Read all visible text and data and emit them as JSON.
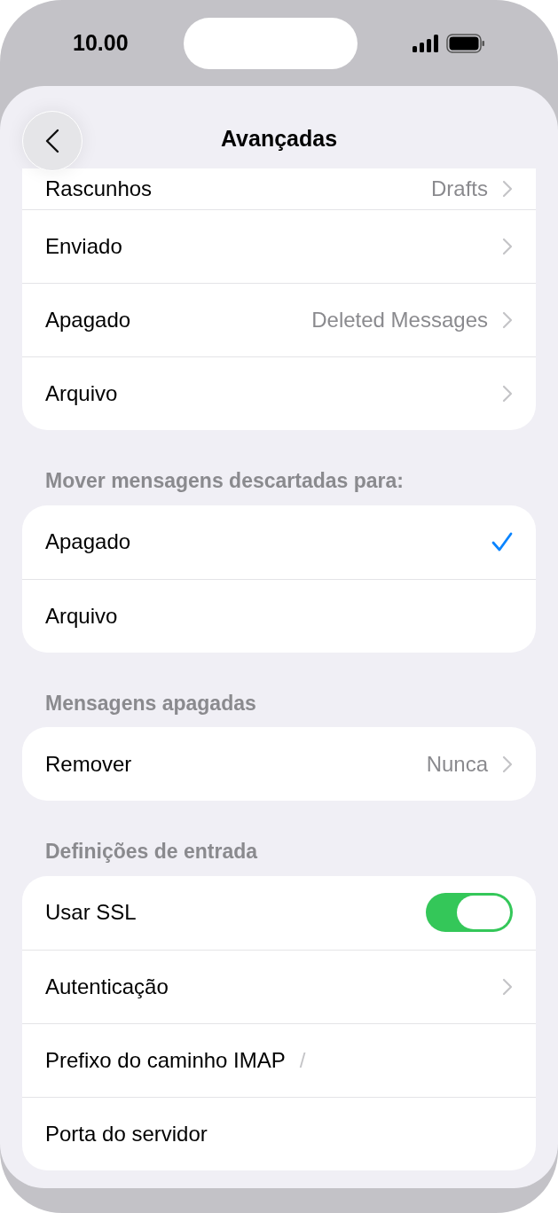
{
  "status_bar": {
    "time": "10.00"
  },
  "nav": {
    "title": "Avançadas"
  },
  "sections": [
    {
      "rows": [
        {
          "kind": "link",
          "label": "Rascunhos",
          "value": "Drafts"
        },
        {
          "kind": "link",
          "label": "Enviado"
        },
        {
          "kind": "link",
          "label": "Apagado",
          "value": "Deleted Messages"
        },
        {
          "kind": "link",
          "label": "Arquivo"
        }
      ]
    },
    {
      "header": "Mover mensagens descartadas para:",
      "rows": [
        {
          "kind": "choice",
          "label": "Apagado",
          "selected": true
        },
        {
          "kind": "choice",
          "label": "Arquivo",
          "selected": false
        }
      ]
    },
    {
      "header": "Mensagens apagadas",
      "rows": [
        {
          "kind": "link",
          "label": "Remover",
          "value": "Nunca"
        }
      ]
    },
    {
      "header": "Definições de entrada",
      "rows": [
        {
          "kind": "toggle",
          "label": "Usar SSL",
          "on": true
        },
        {
          "kind": "link",
          "label": "Autenticação"
        },
        {
          "kind": "field",
          "label": "Prefixo do caminho IMAP",
          "value": "/"
        },
        {
          "kind": "field",
          "label": "Porta do servidor"
        }
      ]
    }
  ]
}
